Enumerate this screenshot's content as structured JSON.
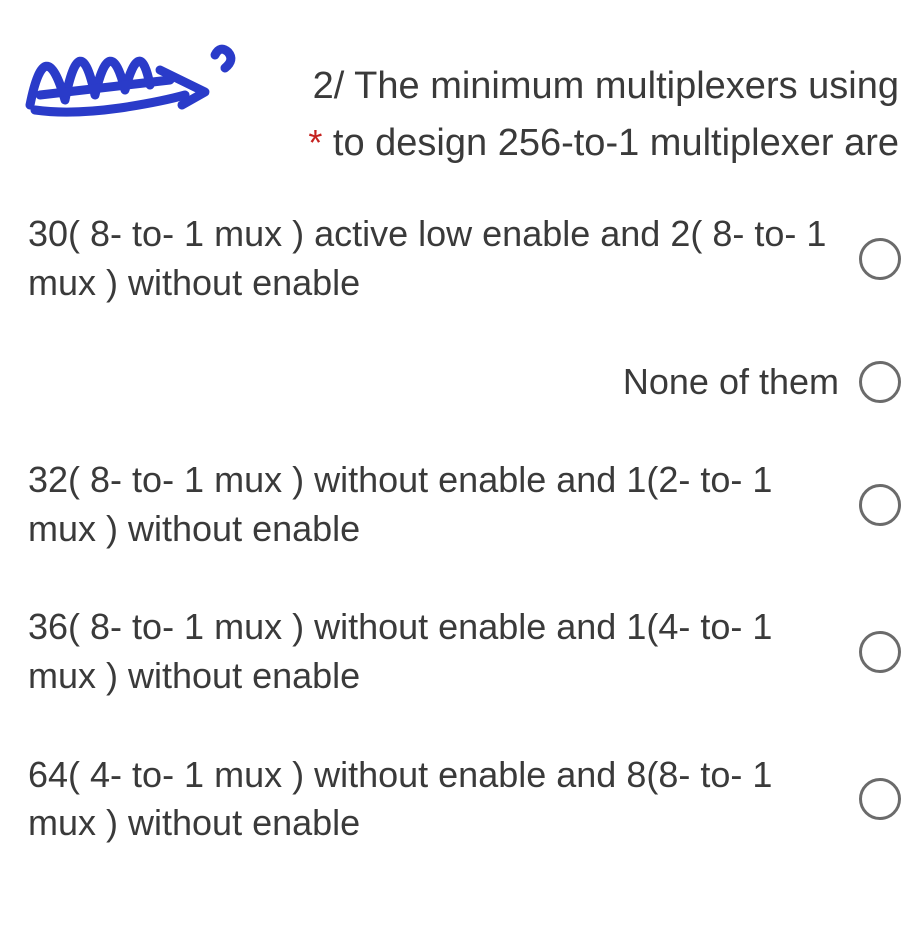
{
  "question": {
    "prefix": "2/",
    "line1": "The minimum multiplexers using",
    "line2": "to design 256-to-1 multiplexer are",
    "asterisk": "*"
  },
  "options": [
    {
      "text": "30( 8- to- 1 mux ) active low enable and 2( 8- to- 1 mux ) without enable",
      "align": "left"
    },
    {
      "text": "None of them",
      "align": "right"
    },
    {
      "text": "32( 8- to- 1 mux ) without enable and 1(2- to- 1 mux ) without enable",
      "align": "left"
    },
    {
      "text": "36( 8- to- 1 mux ) without enable and 1(4- to- 1 mux ) without enable",
      "align": "left"
    },
    {
      "text": "64( 4- to- 1 mux ) without enable and 8(8- to- 1 mux ) without enable",
      "align": "left"
    }
  ]
}
